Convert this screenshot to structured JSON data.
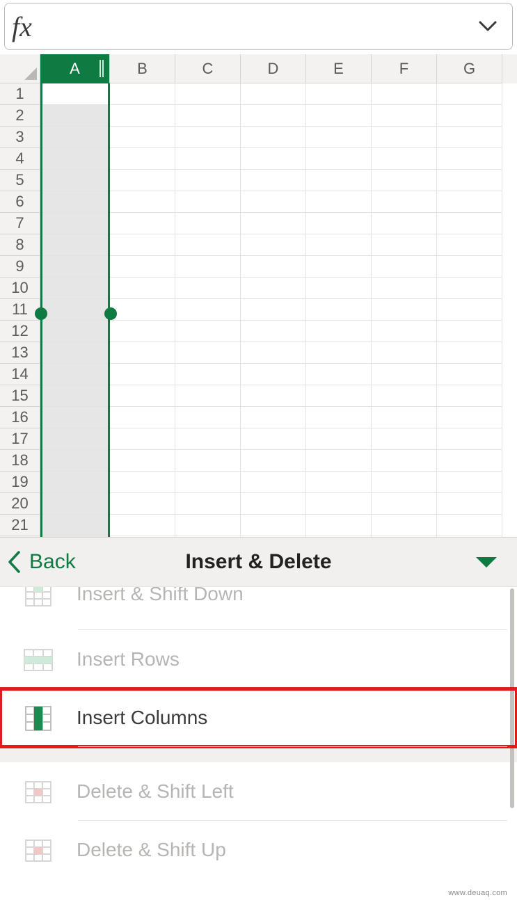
{
  "formula_bar": {
    "fx_label": "fx",
    "value": ""
  },
  "columns": [
    "A",
    "B",
    "C",
    "D",
    "E",
    "F",
    "G"
  ],
  "selected_column_index": 0,
  "visible_rows": 22,
  "selection_handle_row": 11,
  "panel": {
    "back_label": "Back",
    "title": "Insert & Delete",
    "items": [
      {
        "key": "insert-shift-down",
        "label": "Insert & Shift Down",
        "enabled": false
      },
      {
        "key": "insert-rows",
        "label": "Insert Rows",
        "enabled": false
      },
      {
        "key": "insert-columns",
        "label": "Insert Columns",
        "enabled": true,
        "highlighted": true
      },
      {
        "key": "delete-shift-left",
        "label": "Delete & Shift Left",
        "enabled": false
      },
      {
        "key": "delete-shift-up",
        "label": "Delete & Shift Up",
        "enabled": false
      }
    ]
  },
  "watermark": "www.deuaq.com"
}
